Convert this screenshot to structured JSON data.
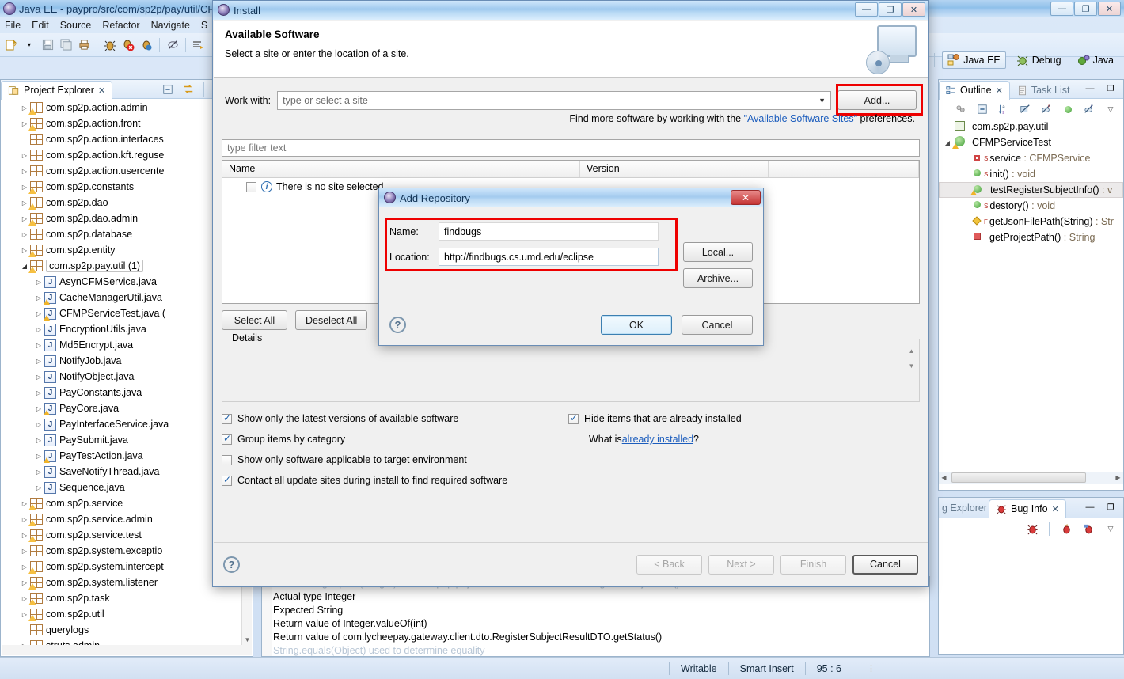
{
  "window": {
    "title": "Java EE - paypro/src/com/sp2p/pay/util/CF",
    "menus": [
      "File",
      "Edit",
      "Source",
      "Refactor",
      "Navigate",
      "S"
    ],
    "min": "—",
    "max": "❐",
    "close": "✕"
  },
  "perspective": {
    "buttons": [
      {
        "label": "Java EE",
        "active": true
      },
      {
        "label": "Debug",
        "active": false
      },
      {
        "label": "Java",
        "active": false
      }
    ]
  },
  "project_explorer": {
    "tab_label": "Project Explorer",
    "close_glyph": "✕",
    "tree": [
      {
        "label": "com.sp2p.action.admin",
        "indent": 1,
        "arrow": "closed",
        "icon": "package-warn"
      },
      {
        "label": "com.sp2p.action.front",
        "indent": 1,
        "arrow": "closed",
        "icon": "package-warn"
      },
      {
        "label": "com.sp2p.action.interfaces",
        "indent": 1,
        "arrow": "none",
        "icon": "package"
      },
      {
        "label": "com.sp2p.action.kft.reguse",
        "indent": 1,
        "arrow": "closed",
        "icon": "package"
      },
      {
        "label": "com.sp2p.action.usercente",
        "indent": 1,
        "arrow": "closed",
        "icon": "package"
      },
      {
        "label": "com.sp2p.constants",
        "indent": 1,
        "arrow": "closed",
        "icon": "package-warn"
      },
      {
        "label": "com.sp2p.dao",
        "indent": 1,
        "arrow": "closed",
        "icon": "package-warn"
      },
      {
        "label": "com.sp2p.dao.admin",
        "indent": 1,
        "arrow": "closed",
        "icon": "package-warn"
      },
      {
        "label": "com.sp2p.database",
        "indent": 1,
        "arrow": "closed",
        "icon": "package"
      },
      {
        "label": "com.sp2p.entity",
        "indent": 1,
        "arrow": "closed",
        "icon": "package-warn"
      },
      {
        "label": "com.sp2p.pay.util (1)",
        "indent": 1,
        "arrow": "open",
        "icon": "package-warn",
        "selected": true
      },
      {
        "label": "AsynCFMService.java",
        "indent": 2,
        "arrow": "closed",
        "icon": "java"
      },
      {
        "label": "CacheManagerUtil.java",
        "indent": 2,
        "arrow": "closed",
        "icon": "java-warn"
      },
      {
        "label": "CFMPServiceTest.java (",
        "indent": 2,
        "arrow": "closed",
        "icon": "java-warn"
      },
      {
        "label": "EncryptionUtils.java",
        "indent": 2,
        "arrow": "closed",
        "icon": "java"
      },
      {
        "label": "Md5Encrypt.java",
        "indent": 2,
        "arrow": "closed",
        "icon": "java"
      },
      {
        "label": "NotifyJob.java",
        "indent": 2,
        "arrow": "closed",
        "icon": "java"
      },
      {
        "label": "NotifyObject.java",
        "indent": 2,
        "arrow": "closed",
        "icon": "java"
      },
      {
        "label": "PayConstants.java",
        "indent": 2,
        "arrow": "closed",
        "icon": "java"
      },
      {
        "label": "PayCore.java",
        "indent": 2,
        "arrow": "closed",
        "icon": "java-warn"
      },
      {
        "label": "PayInterfaceService.java",
        "indent": 2,
        "arrow": "closed",
        "icon": "java"
      },
      {
        "label": "PaySubmit.java",
        "indent": 2,
        "arrow": "closed",
        "icon": "java"
      },
      {
        "label": "PayTestAction.java",
        "indent": 2,
        "arrow": "closed",
        "icon": "java-warn"
      },
      {
        "label": "SaveNotifyThread.java",
        "indent": 2,
        "arrow": "closed",
        "icon": "java"
      },
      {
        "label": "Sequence.java",
        "indent": 2,
        "arrow": "closed",
        "icon": "java"
      },
      {
        "label": "com.sp2p.service",
        "indent": 1,
        "arrow": "closed",
        "icon": "package-warn"
      },
      {
        "label": "com.sp2p.service.admin",
        "indent": 1,
        "arrow": "closed",
        "icon": "package-warn"
      },
      {
        "label": "com.sp2p.service.test",
        "indent": 1,
        "arrow": "closed",
        "icon": "package-warn"
      },
      {
        "label": "com.sp2p.system.exceptio",
        "indent": 1,
        "arrow": "closed",
        "icon": "package"
      },
      {
        "label": "com.sp2p.system.intercept",
        "indent": 1,
        "arrow": "closed",
        "icon": "package-warn"
      },
      {
        "label": "com.sp2p.system.listener",
        "indent": 1,
        "arrow": "closed",
        "icon": "package-warn"
      },
      {
        "label": "com.sp2p.task",
        "indent": 1,
        "arrow": "closed",
        "icon": "package-warn"
      },
      {
        "label": "com.sp2p.util",
        "indent": 1,
        "arrow": "closed",
        "icon": "package-warn"
      },
      {
        "label": "querylogs",
        "indent": 1,
        "arrow": "none",
        "icon": "package"
      },
      {
        "label": "struts.admin",
        "indent": 1,
        "arrow": "closed",
        "icon": "package"
      }
    ]
  },
  "outline": {
    "tab_label": "Outline",
    "tasklist_label": "Task List",
    "close_glyph": "✕",
    "items": [
      {
        "label": "com.sp2p.pay.util",
        "indent": 1,
        "icon": "package",
        "arrow": "none"
      },
      {
        "label": "CFMPServiceTest",
        "indent": 1,
        "icon": "class-warn",
        "arrow": "open"
      },
      {
        "label": "service : CFMPService",
        "indent": 2,
        "icon": "field-private",
        "sup": "S",
        "type_sep": true
      },
      {
        "label": "init() : void",
        "indent": 2,
        "icon": "method-public",
        "sup": "S"
      },
      {
        "label": "testRegisterSubjectInfo() : v",
        "indent": 2,
        "icon": "method-warn",
        "sup": "",
        "selected": true
      },
      {
        "label": "destory() : void",
        "indent": 2,
        "icon": "method-public",
        "sup": "S"
      },
      {
        "label": "getJsonFilePath(String) : Str",
        "indent": 2,
        "icon": "method-default",
        "sup": "F"
      },
      {
        "label": "getProjectPath() : String",
        "indent": 2,
        "icon": "method-private",
        "sup": ""
      }
    ]
  },
  "bug_info": {
    "partial_tab_label": "g Explorer",
    "tab_label": "Bug Info",
    "close_glyph": "✕"
  },
  "install_dialog": {
    "title": "Install",
    "heading": "Available Software",
    "subheading": "Select a site or enter the location of a site.",
    "work_with_label": "Work with:",
    "work_with_value": "type or select a site",
    "add_button": "Add...",
    "hint_prefix": "Find more software by working with the ",
    "hint_link": "\"Available Software Sites\"",
    "hint_suffix": " preferences.",
    "filter_placeholder": "type filter text",
    "columns": [
      "Name",
      "Version"
    ],
    "rows": [
      {
        "name": "There is no site selected",
        "version": "",
        "checked": false
      }
    ],
    "select_all": "Select All",
    "deselect_all": "Deselect All",
    "details_legend": "Details",
    "options_left": [
      {
        "label": "Show only the latest versions of available software",
        "checked": true
      },
      {
        "label": "Group items by category",
        "checked": true
      },
      {
        "label": "Show only software applicable to target environment",
        "checked": false
      },
      {
        "label": "Contact all update sites during install to find required software",
        "checked": true
      }
    ],
    "options_right": [
      {
        "label": "Hide items that are already installed",
        "checked": true
      }
    ],
    "what_is_prefix": "What is ",
    "what_is_link": "already installed",
    "what_is_suffix": "?",
    "footer_buttons": [
      {
        "label": "< Back",
        "enabled": false
      },
      {
        "label": "Next >",
        "enabled": false
      },
      {
        "label": "Finish",
        "enabled": false
      },
      {
        "label": "Cancel",
        "enabled": true,
        "default": true
      }
    ],
    "help_glyph": "?"
  },
  "add_repository_dialog": {
    "title": "Add Repository",
    "close_glyph": "✕",
    "name_label": "Name:",
    "name_value": "findbugs",
    "location_label": "Location:",
    "location_value": "http://findbugs.cs.umd.edu/eclipse",
    "local_button": "Local...",
    "archive_button": "Archive...",
    "ok_button": "OK",
    "cancel_button": "Cancel",
    "help_glyph": "?"
  },
  "console": {
    "lines": [
      {
        "text": "call to String.equals(Integer) in com.sp2p.pay.util.CFMPServiceTest.testRegisterSubjectInfo()",
        "blurred": true
      },
      {
        "text": "Actual type Integer",
        "blurred": false
      },
      {
        "text": "Expected String",
        "blurred": false
      },
      {
        "text": "Return value of Integer.valueOf(int)",
        "blurred": false
      },
      {
        "text": "Return value of com.lycheepay.gateway.client.dto.RegisterSubjectResultDTO.getStatus()",
        "blurred": false
      },
      {
        "text": "String.equals(Object) used to determine equality",
        "blurred": true
      }
    ]
  },
  "statusbar": {
    "writable": "Writable",
    "insert_mode": "Smart Insert",
    "position": "95 : 6"
  },
  "colors": {
    "highlight_red": "#ee0000",
    "link_blue": "#1c5dbd",
    "title_blue": "#15385f"
  }
}
